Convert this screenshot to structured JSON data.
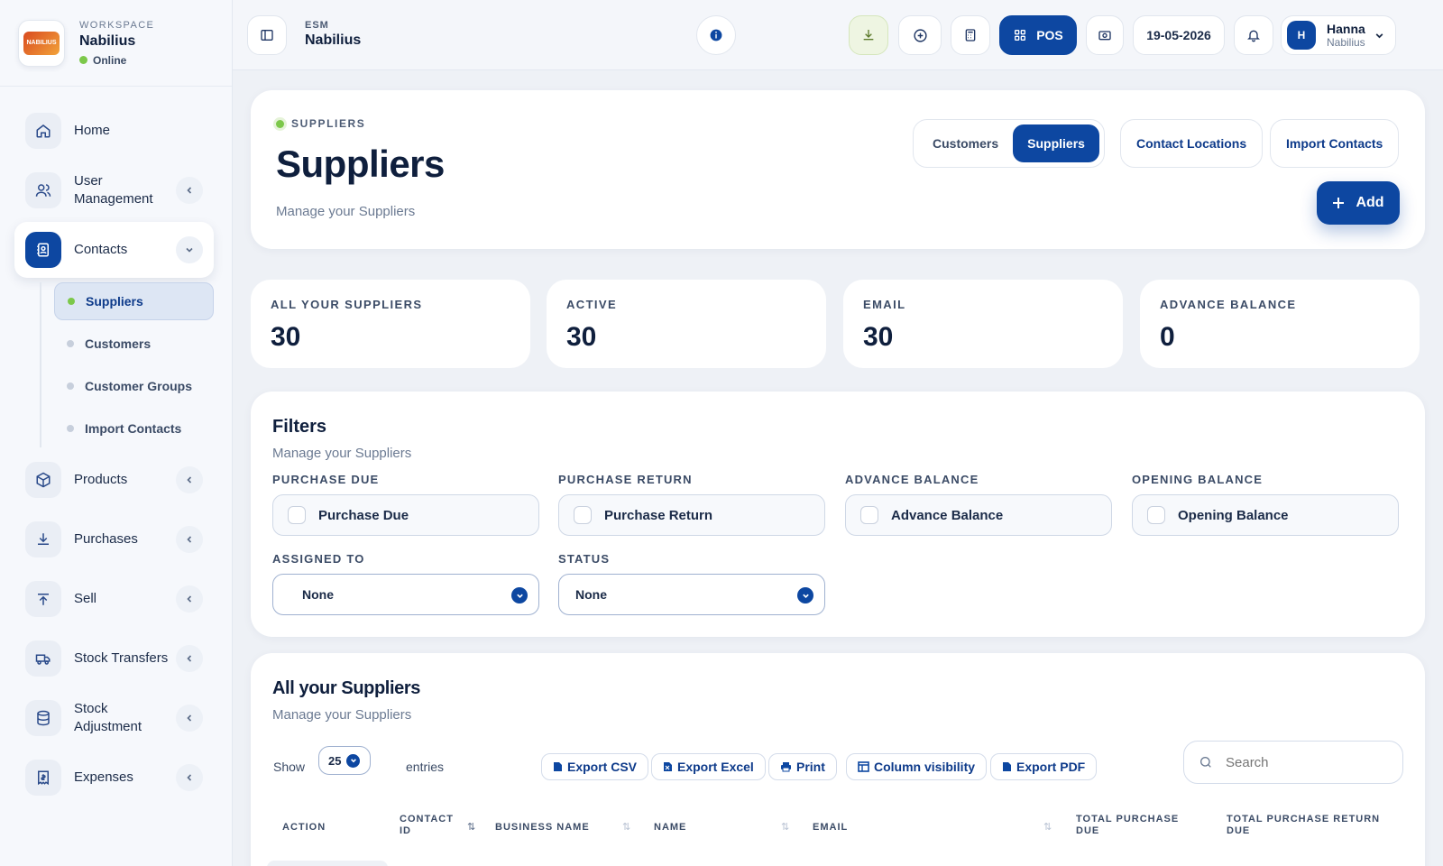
{
  "workspace": {
    "label": "WORKSPACE",
    "name": "Nabilius",
    "status": "Online",
    "logo_text": "NABILIUS"
  },
  "sidebar": {
    "items": [
      {
        "label": "Home",
        "icon": "home-icon"
      },
      {
        "label": "User Management",
        "icon": "users-icon"
      },
      {
        "label": "Contacts",
        "icon": "contacts-icon"
      },
      {
        "label": "Products",
        "icon": "box-icon"
      },
      {
        "label": "Purchases",
        "icon": "download-icon"
      },
      {
        "label": "Sell",
        "icon": "upload-icon"
      },
      {
        "label": "Stock Transfers",
        "icon": "truck-icon"
      },
      {
        "label": "Stock Adjustment",
        "icon": "database-icon"
      },
      {
        "label": "Expenses",
        "icon": "receipt-icon"
      }
    ],
    "contacts_sub": [
      "Suppliers",
      "Customers",
      "Customer Groups",
      "Import Contacts"
    ]
  },
  "topbar": {
    "section": "ESM",
    "title": "Nabilius",
    "pos_label": "POS",
    "date": "19-05-2026",
    "user_initial": "H",
    "user_name": "Hanna",
    "user_org": "Nabilius"
  },
  "header": {
    "eyebrow": "SUPPLIERS",
    "title": "Suppliers",
    "subtitle": "Manage your Suppliers",
    "tabs": [
      "Customers",
      "Suppliers"
    ],
    "active_tab": "Suppliers",
    "contact_locations": "Contact Locations",
    "import_contacts": "Import Contacts",
    "add_label": "Add"
  },
  "stats": [
    {
      "label": "ALL YOUR SUPPLIERS",
      "value": "30"
    },
    {
      "label": "ACTIVE",
      "value": "30"
    },
    {
      "label": "EMAIL",
      "value": "30"
    },
    {
      "label": "ADVANCE BALANCE",
      "value": "0"
    }
  ],
  "filters": {
    "title": "Filters",
    "subtitle": "Manage your Suppliers",
    "checks": [
      {
        "label": "PURCHASE DUE",
        "text": "Purchase Due"
      },
      {
        "label": "PURCHASE RETURN",
        "text": "Purchase Return"
      },
      {
        "label": "ADVANCE BALANCE",
        "text": "Advance Balance"
      },
      {
        "label": "OPENING BALANCE",
        "text": "Opening Balance"
      }
    ],
    "assigned_label": "ASSIGNED TO",
    "assigned_value": "None",
    "status_label": "STATUS",
    "status_value": "None"
  },
  "table_section": {
    "title": "All your Suppliers",
    "subtitle": "Manage your Suppliers",
    "show_label": "Show",
    "entries_value": "25",
    "entries_label": "entries",
    "buttons": [
      "Export CSV",
      "Export Excel",
      "Print",
      "Column visibility",
      "Export PDF"
    ],
    "search_placeholder": "Search",
    "columns": [
      "ACTION",
      "CONTACT ID",
      "BUSINESS NAME",
      "NAME",
      "EMAIL",
      "TOTAL PURCHASE DUE",
      "TOTAL PURCHASE RETURN DUE"
    ]
  },
  "colors": {
    "primary": "#0d47a1",
    "online": "#7cc84a",
    "bg": "#eef1f6"
  }
}
